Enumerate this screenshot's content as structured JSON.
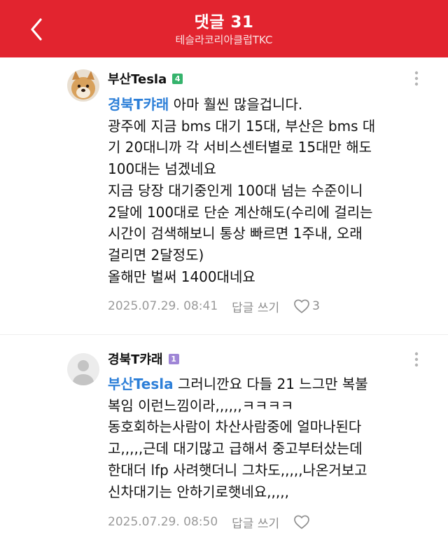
{
  "header": {
    "title": "댓글 31",
    "subtitle": "테슬라코리아클럽TKC"
  },
  "comments": [
    {
      "author": "부산Tesla",
      "level_badge": "4",
      "badge_color": "#35b36c",
      "mention": "경북T캬래",
      "lines": [
        " 아마 훨씬 많을겁니다.",
        "광주에 지금 bms 대기 15대, 부산은 bms 대",
        "기 20대니까 각 서비스센터별로 15대만 해도",
        "100대는 넘겠네요",
        "지금 당장 대기중인게 100대 넘는 수준이니",
        "2달에 100대로 단순 계산해도(수리에 걸리는",
        "시간이 검색해보니 통상 빠르면 1주내, 오래",
        "걸리면 2달정도)",
        "올해만 벌써 1400대네요"
      ],
      "timestamp": "2025.07.29. 08:41",
      "reply_label": "답글 쓰기",
      "likes": "3"
    },
    {
      "author": "경북T캬래",
      "level_badge": "1",
      "badge_color": "#9f86d6",
      "mention": "부산Tesla",
      "lines": [
        " 그러니깐요 다들 21 느그만 복불",
        "복임 이런느낌이라,,,,,,ㅋㅋㅋㅋ",
        "동호회하는사람이 차산사람중에 얼마나된다",
        "고,,,,,근데 대기많고 급해서 중고부터샀는데",
        "한대더 lfp 사려햇더니 그차도,,,,,나온거보고",
        "신차대기는 안하기로햇네요,,,,,"
      ],
      "timestamp": "2025.07.29. 08:50",
      "reply_label": "답글 쓰기",
      "likes": ""
    }
  ],
  "colors": {
    "header_bg": "#e2242f",
    "mention": "#2d7fd8",
    "meta_text": "#9a9a9a"
  },
  "icons": {
    "back": "chevron-left-icon",
    "more": "more-vertical-icon",
    "like": "heart-outline-icon"
  }
}
